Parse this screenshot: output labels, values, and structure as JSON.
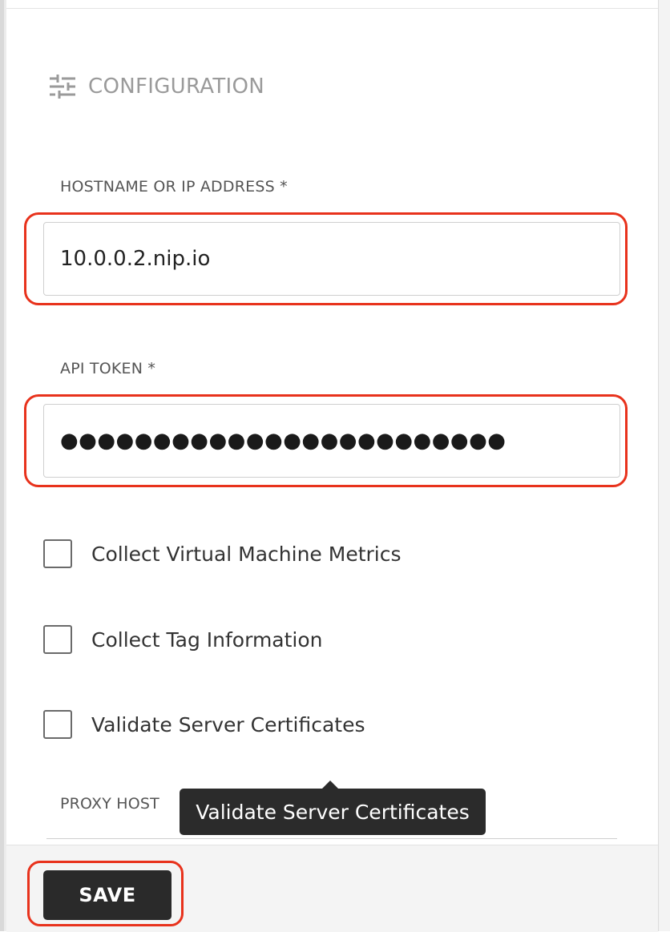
{
  "section": {
    "title": "CONFIGURATION",
    "icon": "sliders-icon"
  },
  "fields": {
    "hostname": {
      "label": "HOSTNAME OR IP ADDRESS *",
      "value": "10.0.0.2.nip.io"
    },
    "api_token": {
      "label": "API TOKEN *",
      "masked_value": "●●●●●●●●●●●●●●●●●●●●●●●●"
    },
    "proxy_host": {
      "label": "PROXY HOST"
    }
  },
  "checkboxes": [
    {
      "label": "Collect Virtual Machine Metrics",
      "checked": false
    },
    {
      "label": "Collect Tag Information",
      "checked": false
    },
    {
      "label": "Validate Server Certificates",
      "checked": false
    }
  ],
  "tooltip": {
    "text": "Validate Server Certificates"
  },
  "footer": {
    "save_label": "SAVE"
  },
  "colors": {
    "highlight": "#e8321c",
    "button_bg": "#2a2a2a",
    "tooltip_bg": "#2b2b2b"
  }
}
